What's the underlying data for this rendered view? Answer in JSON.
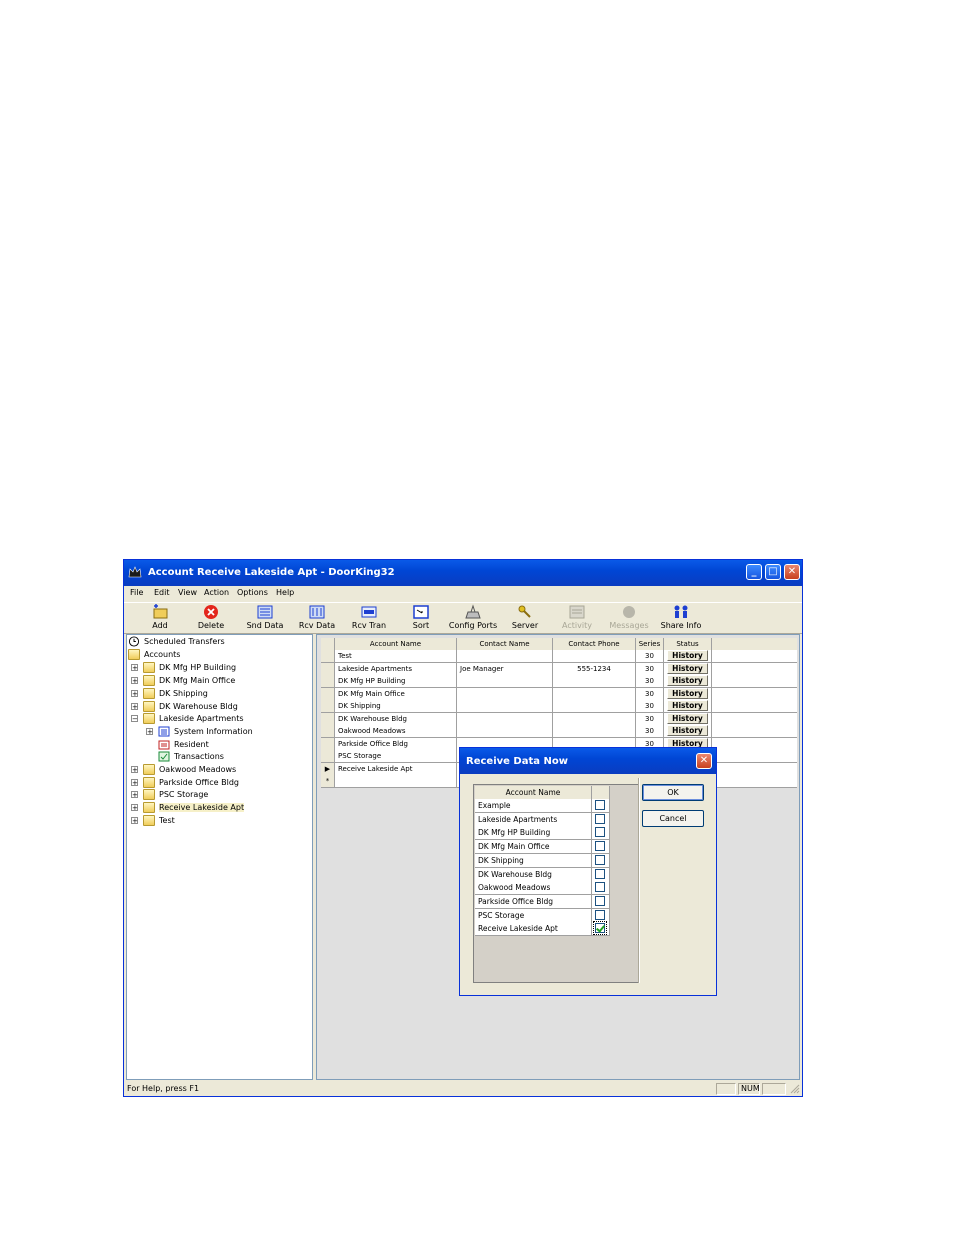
{
  "window": {
    "title": "Account Receive Lakeside Apt - DoorKing32",
    "minimize_label": "_",
    "maximize_label": "□",
    "close_label": "✕"
  },
  "menu": [
    "File",
    "Edit",
    "View",
    "Action",
    "Options",
    "Help"
  ],
  "toolbar": [
    {
      "label": "Add",
      "icon": "add-icon",
      "enabled": true
    },
    {
      "label": "Delete",
      "icon": "delete-icon",
      "enabled": true
    },
    {
      "label": "Snd Data",
      "icon": "send-data-icon",
      "enabled": true
    },
    {
      "label": "Rcv Data",
      "icon": "receive-data-icon",
      "enabled": true
    },
    {
      "label": "Rcv Tran",
      "icon": "receive-transactions-icon",
      "enabled": true
    },
    {
      "label": "Sort",
      "icon": "sort-icon",
      "enabled": true
    },
    {
      "label": "Config Ports",
      "icon": "config-ports-icon",
      "enabled": true
    },
    {
      "label": "Server",
      "icon": "server-icon",
      "enabled": true
    },
    {
      "label": "Activity",
      "icon": "activity-icon",
      "enabled": false
    },
    {
      "label": "Messages",
      "icon": "messages-icon",
      "enabled": false
    },
    {
      "label": "Share Info",
      "icon": "share-info-icon",
      "enabled": true
    }
  ],
  "tree": {
    "scheduled": "Scheduled Transfers",
    "accounts": "Accounts",
    "items": [
      "DK Mfg HP Building",
      "DK Mfg Main Office",
      "DK Shipping",
      "DK Warehouse Bldg",
      "Lakeside Apartments",
      "System Information",
      "Resident",
      "Transactions",
      "Oakwood Meadows",
      "Parkside Office Bldg",
      "PSC Storage",
      "Receive Lakeside Apt",
      "Test"
    ],
    "selected": "Receive Lakeside Apt"
  },
  "grid": {
    "headers": [
      "Account Name",
      "Contact Name",
      "Contact Phone",
      "Series",
      "Status"
    ],
    "rows": [
      {
        "name": "Test",
        "contact": "",
        "phone": "",
        "series": "30",
        "status": "History"
      },
      {
        "name": "Lakeside Apartments",
        "contact": "Joe Manager",
        "phone": "555-1234",
        "series": "30",
        "status": "History"
      },
      {
        "name": "DK Mfg HP Building",
        "contact": "",
        "phone": "",
        "series": "30",
        "status": "History"
      },
      {
        "name": "DK Mfg Main Office",
        "contact": "",
        "phone": "",
        "series": "30",
        "status": "History"
      },
      {
        "name": "DK Shipping",
        "contact": "",
        "phone": "",
        "series": "30",
        "status": "History"
      },
      {
        "name": "DK Warehouse Bldg",
        "contact": "",
        "phone": "",
        "series": "30",
        "status": "History"
      },
      {
        "name": "Oakwood Meadows",
        "contact": "",
        "phone": "",
        "series": "30",
        "status": "History"
      },
      {
        "name": "Parkside Office Bldg",
        "contact": "",
        "phone": "",
        "series": "30",
        "status": "History"
      },
      {
        "name": "PSC Storage",
        "contact": "",
        "phone": "",
        "series": "",
        "status": ""
      },
      {
        "name": "Receive Lakeside Apt",
        "contact": "",
        "phone": "",
        "series": "",
        "status": ""
      }
    ],
    "current_row_marker": "▶",
    "new_row_marker": "*"
  },
  "statusbar": {
    "text": "For Help, press F1",
    "num": "NUM"
  },
  "dialog": {
    "title": "Receive Data Now",
    "list_header": "Account Name",
    "accounts": [
      {
        "name": "Example",
        "checked": false
      },
      {
        "name": "Lakeside Apartments",
        "checked": false
      },
      {
        "name": "DK Mfg HP Building",
        "checked": false
      },
      {
        "name": "DK Mfg Main Office",
        "checked": false
      },
      {
        "name": "DK Shipping",
        "checked": false
      },
      {
        "name": "DK Warehouse Bldg",
        "checked": false
      },
      {
        "name": "Oakwood Meadows",
        "checked": false
      },
      {
        "name": "Parkside Office Bldg",
        "checked": false
      },
      {
        "name": "PSC Storage",
        "checked": false
      },
      {
        "name": "Receive Lakeside Apt",
        "checked": true
      }
    ],
    "ok_label": "OK",
    "cancel_label": "Cancel"
  }
}
